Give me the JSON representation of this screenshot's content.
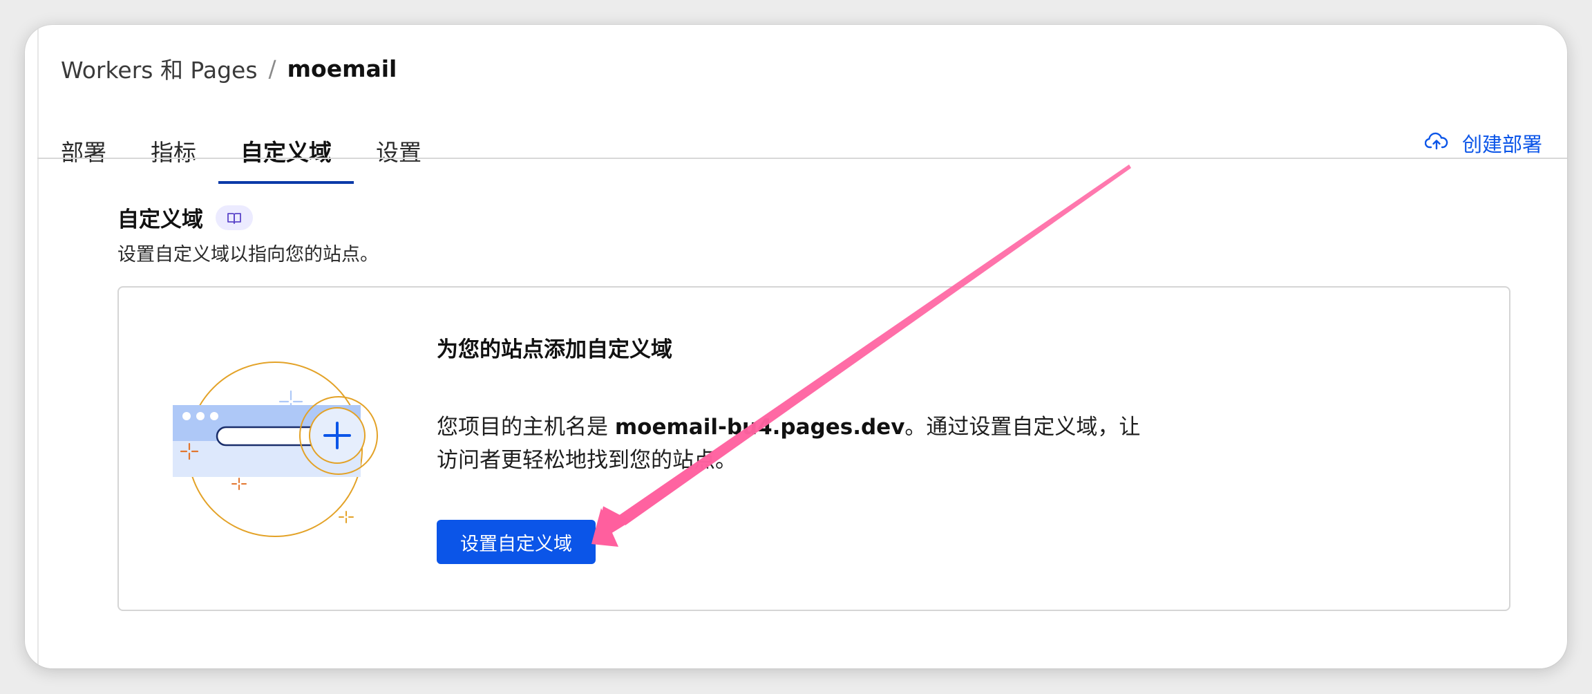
{
  "breadcrumb": {
    "parent": "Workers 和 Pages",
    "separator": "/",
    "current": "moemail"
  },
  "tabs": [
    {
      "label": "部署",
      "active": false
    },
    {
      "label": "指标",
      "active": false
    },
    {
      "label": "自定义域",
      "active": true
    },
    {
      "label": "设置",
      "active": false
    }
  ],
  "actions": {
    "create_deploy_label": "创建部署",
    "create_deploy_icon": "cloud-upload-icon"
  },
  "section": {
    "title": "自定义域",
    "badge_icon": "book-icon",
    "description": "设置自定义域以指向您的站点。"
  },
  "card": {
    "title": "为您的站点添加自定义域",
    "body_prefix": "您项目的主机名是 ",
    "hostname": "moemail-bu4.pages.dev",
    "body_suffix": "。通过设置自定义域，让访问者更轻松地找到您的站点。",
    "button_label": "设置自定义域",
    "illustration_icon": "add-domain-illustration"
  },
  "annotation": {
    "arrow_color": "#ff6ba6"
  },
  "colors": {
    "accent": "#0b55e8",
    "tab_underline": "#0b3aa8",
    "illustration_gold": "#e3a227",
    "illustration_blue": "#aec8f7",
    "illustration_orange": "#e2762f"
  }
}
